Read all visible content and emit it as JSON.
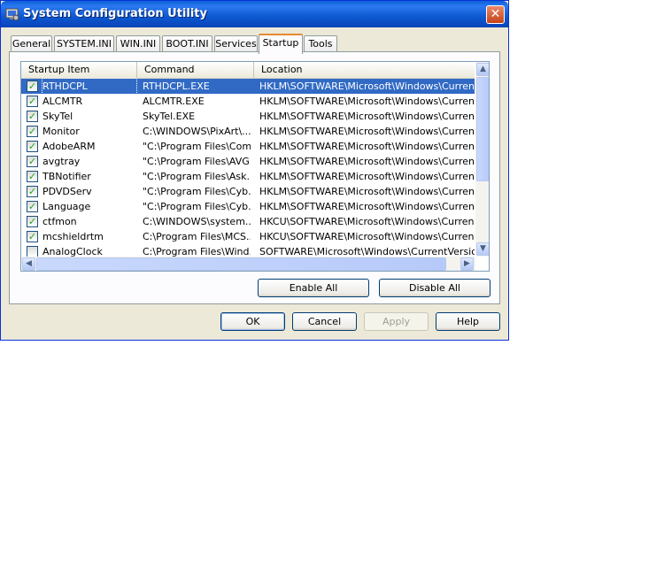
{
  "window": {
    "title": "System Configuration Utility",
    "close_symbol": "✕"
  },
  "tabs": [
    {
      "label": "General"
    },
    {
      "label": "SYSTEM.INI"
    },
    {
      "label": "WIN.INI"
    },
    {
      "label": "BOOT.INI"
    },
    {
      "label": "Services"
    },
    {
      "label": "Startup",
      "active": true
    },
    {
      "label": "Tools"
    }
  ],
  "startup_list": {
    "columns": [
      "Startup Item",
      "Command",
      "Location"
    ],
    "rows": [
      {
        "checked": true,
        "item": "RTHDCPL",
        "command": "RTHDCPL.EXE",
        "location": "HKLM\\SOFTWARE\\Microsoft\\Windows\\CurrentVer...",
        "selected": true
      },
      {
        "checked": true,
        "item": "ALCMTR",
        "command": "ALCMTR.EXE",
        "location": "HKLM\\SOFTWARE\\Microsoft\\Windows\\CurrentVer..."
      },
      {
        "checked": true,
        "item": "SkyTel",
        "command": "SkyTel.EXE",
        "location": "HKLM\\SOFTWARE\\Microsoft\\Windows\\CurrentVer..."
      },
      {
        "checked": true,
        "item": "Monitor",
        "command": "C:\\WINDOWS\\PixArt\\...",
        "location": "HKLM\\SOFTWARE\\Microsoft\\Windows\\CurrentVer..."
      },
      {
        "checked": true,
        "item": "AdobeARM",
        "command": "\"C:\\Program Files\\Com...",
        "location": "HKLM\\SOFTWARE\\Microsoft\\Windows\\CurrentVer..."
      },
      {
        "checked": true,
        "item": "avgtray",
        "command": "\"C:\\Program Files\\AVG...",
        "location": "HKLM\\SOFTWARE\\Microsoft\\Windows\\CurrentVer..."
      },
      {
        "checked": true,
        "item": "TBNotifier",
        "command": "\"C:\\Program Files\\Ask...",
        "location": "HKLM\\SOFTWARE\\Microsoft\\Windows\\CurrentVer..."
      },
      {
        "checked": true,
        "item": "PDVDServ",
        "command": "\"C:\\Program Files\\Cyb...",
        "location": "HKLM\\SOFTWARE\\Microsoft\\Windows\\CurrentVer..."
      },
      {
        "checked": true,
        "item": "Language",
        "command": "\"C:\\Program Files\\Cyb...",
        "location": "HKLM\\SOFTWARE\\Microsoft\\Windows\\CurrentVer..."
      },
      {
        "checked": true,
        "item": "ctfmon",
        "command": "C:\\WINDOWS\\system...",
        "location": "HKCU\\SOFTWARE\\Microsoft\\Windows\\CurrentVer..."
      },
      {
        "checked": true,
        "item": "mcshieldrtm",
        "command": "C:\\Program Files\\MCS...",
        "location": "HKCU\\SOFTWARE\\Microsoft\\Windows\\CurrentVer..."
      },
      {
        "checked": false,
        "item": "AnalogClock",
        "command": "C:\\Program Files\\Wind...",
        "location": "SOFTWARE\\Microsoft\\Windows\\CurrentVersion\\Ru..."
      }
    ]
  },
  "buttons": {
    "enable_all": "Enable All",
    "disable_all": "Disable All",
    "ok": "OK",
    "cancel": "Cancel",
    "apply": "Apply",
    "help": "Help"
  },
  "scroll_glyphs": {
    "up": "▲",
    "down": "▼",
    "left": "◀",
    "right": "▶"
  },
  "colors": {
    "selection": "#316ac5",
    "titlebar": "#0a5fd8",
    "active_tab_accent": "#e68b2c"
  }
}
